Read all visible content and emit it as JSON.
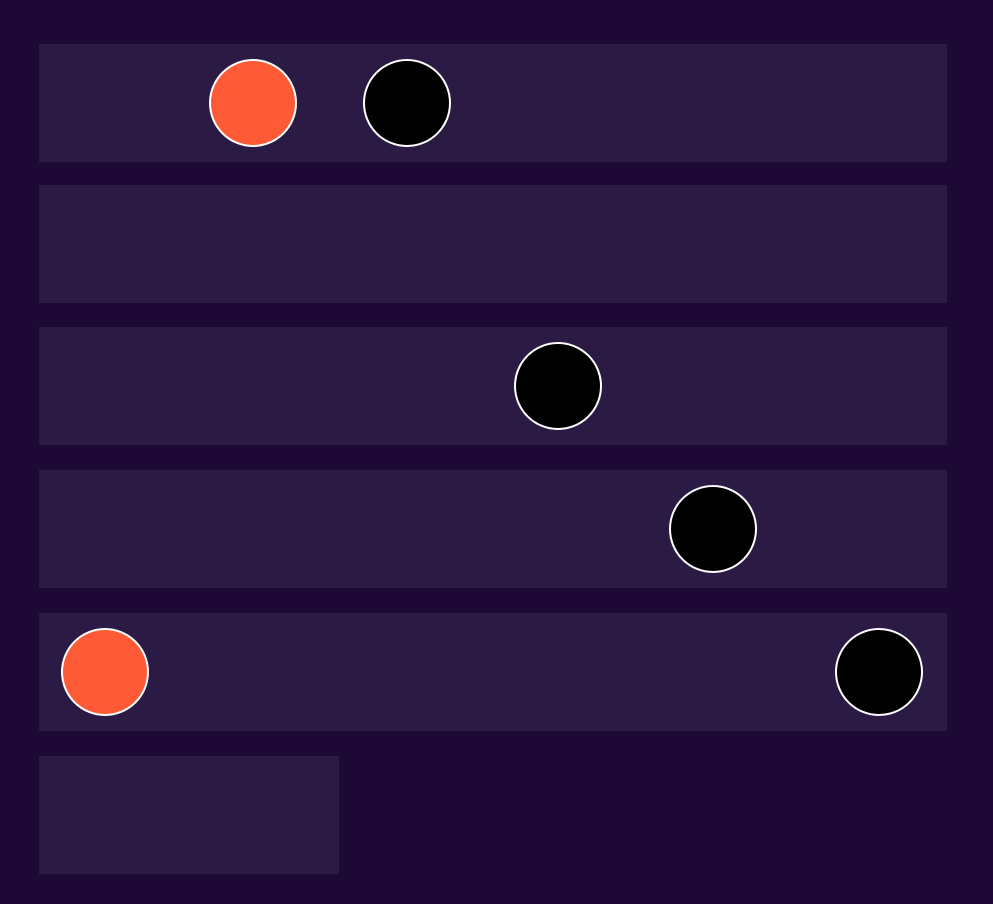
{
  "board": {
    "background_color": "#1e0936",
    "lane_color": "#2b1a43",
    "piece_border_color": "#ffffff",
    "lanes": [
      {
        "pieces": [
          {
            "color": "#ff5a36"
          },
          {
            "color": "#000000"
          }
        ]
      },
      {
        "pieces": []
      },
      {
        "pieces": [
          {
            "color": "#000000"
          }
        ]
      },
      {
        "pieces": [
          {
            "color": "#000000"
          }
        ]
      },
      {
        "pieces": [
          {
            "color": "#ff5a36"
          },
          {
            "color": "#000000"
          }
        ]
      },
      {
        "pieces": [],
        "partial": true
      }
    ]
  }
}
